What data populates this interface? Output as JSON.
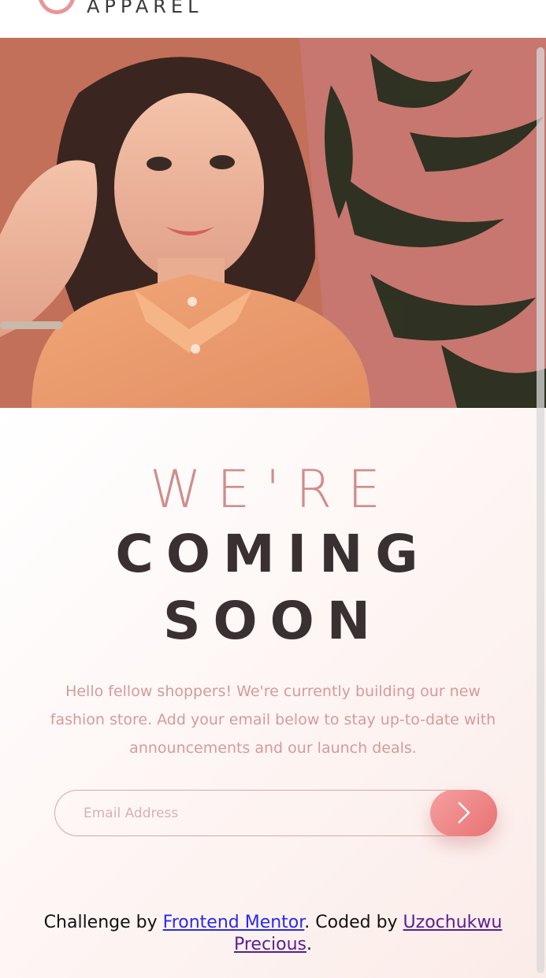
{
  "brand": {
    "logo_text": "APPAREL"
  },
  "hero": {
    "image_alt": "Woman in an orange shirt"
  },
  "heading": {
    "line1": "WE'RE",
    "line2": "COMING",
    "line3": "SOON"
  },
  "description": "Hello fellow shoppers! We're currently building our new fashion store. Add your email below to stay up-to-date with announcements and our launch deals.",
  "form": {
    "email_placeholder": "Email Address",
    "submit_icon": "chevron-right-icon"
  },
  "footer": {
    "prefix": "Challenge by ",
    "mentor_link": "Frontend Mentor",
    "middle": ". Coded by ",
    "author_link": "Uzochukwu Precious",
    "suffix": "."
  },
  "colors": {
    "accent": "#e7969a",
    "dark_text": "#3b3031",
    "light_text": "#cf8d8c",
    "button": "#f69f9f"
  }
}
